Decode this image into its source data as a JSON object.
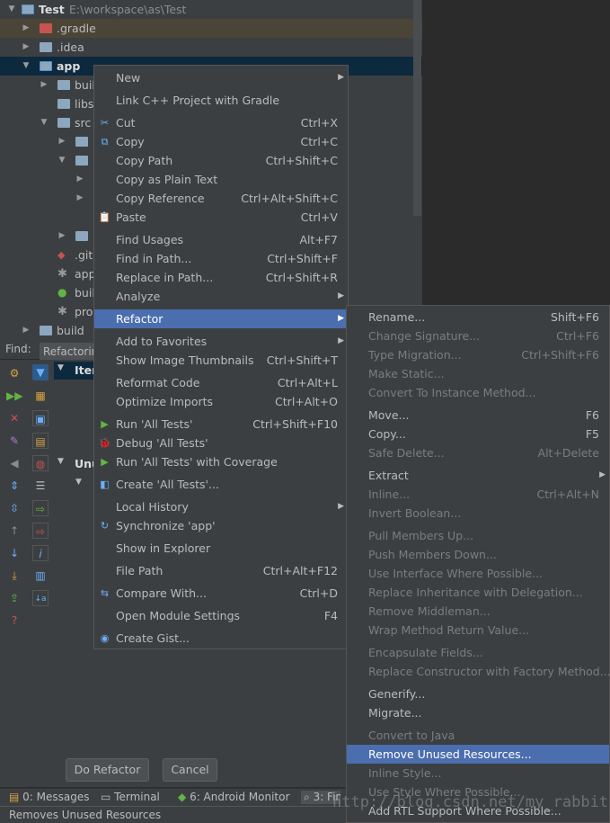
{
  "tree": {
    "project_name": "Test",
    "project_path": "E:\\workspace\\as\\Test",
    "rows": [
      {
        "label": ".gradle"
      },
      {
        "label": ".idea"
      },
      {
        "label": "app"
      },
      {
        "label": "buil"
      },
      {
        "label": "libs"
      },
      {
        "label": "src"
      },
      {
        "label": ""
      },
      {
        "label": ""
      },
      {
        "label": ""
      },
      {
        "label": ""
      },
      {
        "label": ""
      },
      {
        "label": ""
      },
      {
        "label": ".giti"
      },
      {
        "label": "app"
      },
      {
        "label": "buil"
      },
      {
        "label": "pro"
      },
      {
        "label": "build"
      }
    ]
  },
  "find": {
    "label": "Find:",
    "tab": "Refactorin",
    "items_header": "Iter",
    "unused_header": "Unu"
  },
  "context_menu": {
    "items": [
      {
        "label": "New",
        "shortcut": "",
        "submenu": true
      },
      {
        "label": "Link C++ Project with Gradle",
        "shortcut": ""
      },
      {
        "label": "Cut",
        "shortcut": "Ctrl+X",
        "icon": "✂"
      },
      {
        "label": "Copy",
        "shortcut": "Ctrl+C",
        "icon": "⧉"
      },
      {
        "label": "Copy Path",
        "shortcut": "Ctrl+Shift+C"
      },
      {
        "label": "Copy as Plain Text",
        "shortcut": ""
      },
      {
        "label": "Copy Reference",
        "shortcut": "Ctrl+Alt+Shift+C"
      },
      {
        "label": "Paste",
        "shortcut": "Ctrl+V",
        "icon": "📋"
      },
      {
        "label": "Find Usages",
        "shortcut": "Alt+F7"
      },
      {
        "label": "Find in Path...",
        "shortcut": "Ctrl+Shift+F"
      },
      {
        "label": "Replace in Path...",
        "shortcut": "Ctrl+Shift+R"
      },
      {
        "label": "Analyze",
        "shortcut": "",
        "submenu": true
      },
      {
        "label": "Refactor",
        "shortcut": "",
        "submenu": true
      },
      {
        "label": "Add to Favorites",
        "shortcut": "",
        "submenu": true
      },
      {
        "label": "Show Image Thumbnails",
        "shortcut": "Ctrl+Shift+T"
      },
      {
        "label": "Reformat Code",
        "shortcut": "Ctrl+Alt+L"
      },
      {
        "label": "Optimize Imports",
        "shortcut": "Ctrl+Alt+O"
      },
      {
        "label": "Run 'All Tests'",
        "shortcut": "Ctrl+Shift+F10",
        "icon": "▶"
      },
      {
        "label": "Debug 'All Tests'",
        "shortcut": "",
        "icon": "🐞"
      },
      {
        "label": "Run 'All Tests' with Coverage",
        "shortcut": "",
        "icon": "▶"
      },
      {
        "label": "Create 'All Tests'...",
        "shortcut": "",
        "icon": "◧"
      },
      {
        "label": "Local History",
        "shortcut": "",
        "submenu": true
      },
      {
        "label": "Synchronize 'app'",
        "shortcut": "",
        "icon": "↻"
      },
      {
        "label": "Show in Explorer",
        "shortcut": ""
      },
      {
        "label": "File Path",
        "shortcut": "Ctrl+Alt+F12"
      },
      {
        "label": "Compare With...",
        "shortcut": "Ctrl+D",
        "icon": "⇆"
      },
      {
        "label": "Open Module Settings",
        "shortcut": "F4"
      },
      {
        "label": "Create Gist...",
        "shortcut": "",
        "icon": "◉"
      }
    ]
  },
  "refactor_menu": {
    "items": [
      {
        "label": "Rename...",
        "shortcut": "Shift+F6",
        "enabled": true
      },
      {
        "label": "Change Signature...",
        "shortcut": "Ctrl+F6",
        "enabled": false
      },
      {
        "label": "Type Migration...",
        "shortcut": "Ctrl+Shift+F6",
        "enabled": false
      },
      {
        "label": "Make Static...",
        "shortcut": "",
        "enabled": false
      },
      {
        "label": "Convert To Instance Method...",
        "shortcut": "",
        "enabled": false
      },
      {
        "label": "Move...",
        "shortcut": "F6",
        "enabled": true
      },
      {
        "label": "Copy...",
        "shortcut": "F5",
        "enabled": true
      },
      {
        "label": "Safe Delete...",
        "shortcut": "Alt+Delete",
        "enabled": false
      },
      {
        "label": "Extract",
        "shortcut": "",
        "enabled": true,
        "submenu": true
      },
      {
        "label": "Inline...",
        "shortcut": "Ctrl+Alt+N",
        "enabled": false
      },
      {
        "label": "Invert Boolean...",
        "shortcut": "",
        "enabled": false
      },
      {
        "label": "Pull Members Up...",
        "shortcut": "",
        "enabled": false
      },
      {
        "label": "Push Members Down...",
        "shortcut": "",
        "enabled": false
      },
      {
        "label": "Use Interface Where Possible...",
        "shortcut": "",
        "enabled": false
      },
      {
        "label": "Replace Inheritance with Delegation...",
        "shortcut": "",
        "enabled": false
      },
      {
        "label": "Remove Middleman...",
        "shortcut": "",
        "enabled": false
      },
      {
        "label": "Wrap Method Return Value...",
        "shortcut": "",
        "enabled": false
      },
      {
        "label": "Encapsulate Fields...",
        "shortcut": "",
        "enabled": false
      },
      {
        "label": "Replace Constructor with Factory Method...",
        "shortcut": "",
        "enabled": false
      },
      {
        "label": "Generify...",
        "shortcut": "",
        "enabled": true
      },
      {
        "label": "Migrate...",
        "shortcut": "",
        "enabled": true
      },
      {
        "label": "Convert to Java",
        "shortcut": "",
        "enabled": false
      },
      {
        "label": "Remove Unused Resources...",
        "shortcut": "",
        "enabled": true,
        "selected": true
      },
      {
        "label": "Inline Style...",
        "shortcut": "",
        "enabled": false
      },
      {
        "label": "Use Style Where Possible...",
        "shortcut": "",
        "enabled": false
      },
      {
        "label": "Add RTL Support Where Possible...",
        "shortcut": "",
        "enabled": true
      }
    ]
  },
  "buttons": {
    "do_refactor": "Do Refactor",
    "cancel": "Cancel"
  },
  "bottom_tabs": [
    {
      "label": "0: Messages"
    },
    {
      "label": "Terminal"
    },
    {
      "label": "6: Android Monitor"
    },
    {
      "label": "3: Fin"
    }
  ],
  "status": {
    "text": "Removes Unused Resources"
  },
  "watermark": "http://blog.csdn.net/my_rabbit"
}
